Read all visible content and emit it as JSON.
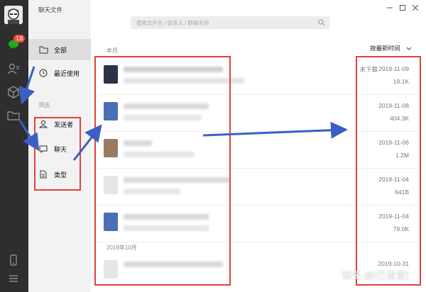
{
  "window": {
    "title": "聊天文件"
  },
  "rail": {
    "badge": "18"
  },
  "search": {
    "placeholder": "搜索文件名 / 联系人 / 群聊名称"
  },
  "categories": {
    "all": "全部",
    "recent": "最近使用",
    "filter_label": "筛选",
    "sender": "发送者",
    "chat": "聊天",
    "type": "类型"
  },
  "list": {
    "sort_label": "按最新时间",
    "month1": "本月",
    "month2": "2019年10月",
    "rows": [
      {
        "status": "未下载",
        "date": "2019-11-09",
        "size": "19.1K"
      },
      {
        "status": "",
        "date": "2019-11-08",
        "size": "404.3K"
      },
      {
        "status": "",
        "date": "2019-11-06",
        "size": "1.2M"
      },
      {
        "status": "",
        "date": "2019-11-04",
        "size": "641B"
      },
      {
        "status": "",
        "date": "2019-11-04",
        "size": "79.0K"
      },
      {
        "status": "",
        "date": "2019-10-31",
        "size": ""
      }
    ]
  },
  "watermark": "知乎 @[已重置]",
  "colors": {
    "rail": "#2e2e2e",
    "annotation": "#e0423a",
    "arrow": "#3b5fc4"
  }
}
